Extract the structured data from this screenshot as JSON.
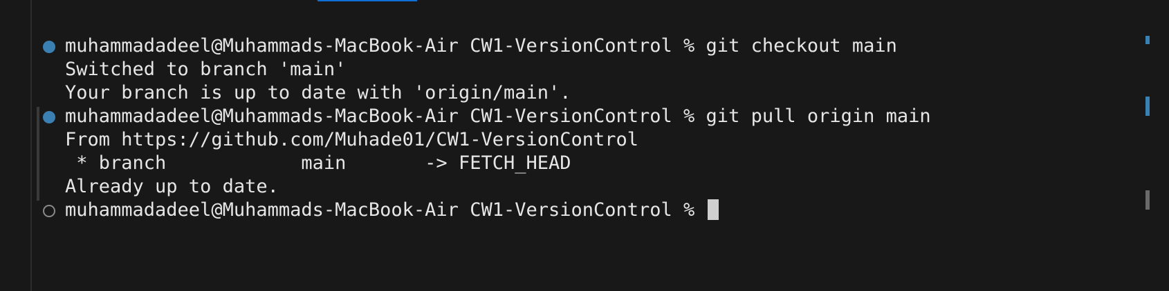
{
  "terminal": {
    "lines": [
      {
        "decoration": "success",
        "text": "muhammadadeel@Muhammads-MacBook-Air CW1-VersionControl % git checkout main"
      },
      {
        "decoration": "none",
        "text": "Switched to branch 'main'"
      },
      {
        "decoration": "none",
        "text": "Your branch is up to date with 'origin/main'."
      },
      {
        "decoration": "success",
        "text": "muhammadadeel@Muhammads-MacBook-Air CW1-VersionControl % git pull origin main"
      },
      {
        "decoration": "none",
        "text": "From https://github.com/Muhade01/CW1-VersionControl"
      },
      {
        "decoration": "none",
        "text": " * branch            main       -> FETCH_HEAD"
      },
      {
        "decoration": "none",
        "text": "Already up to date."
      },
      {
        "decoration": "pending",
        "text": "muhammadadeel@Muhammads-MacBook-Air CW1-VersionControl % "
      }
    ]
  },
  "colors": {
    "background": "#181818",
    "text": "#e6e6e6",
    "success_decoration": "#3b80b3",
    "pending_decoration": "#8a8a8a",
    "cursor": "#cfcfcf",
    "overview_blue": "#3b80b3",
    "overview_gray": "#6a6a6a"
  },
  "icons": {
    "success": "command-success-icon",
    "pending": "command-pending-icon"
  }
}
